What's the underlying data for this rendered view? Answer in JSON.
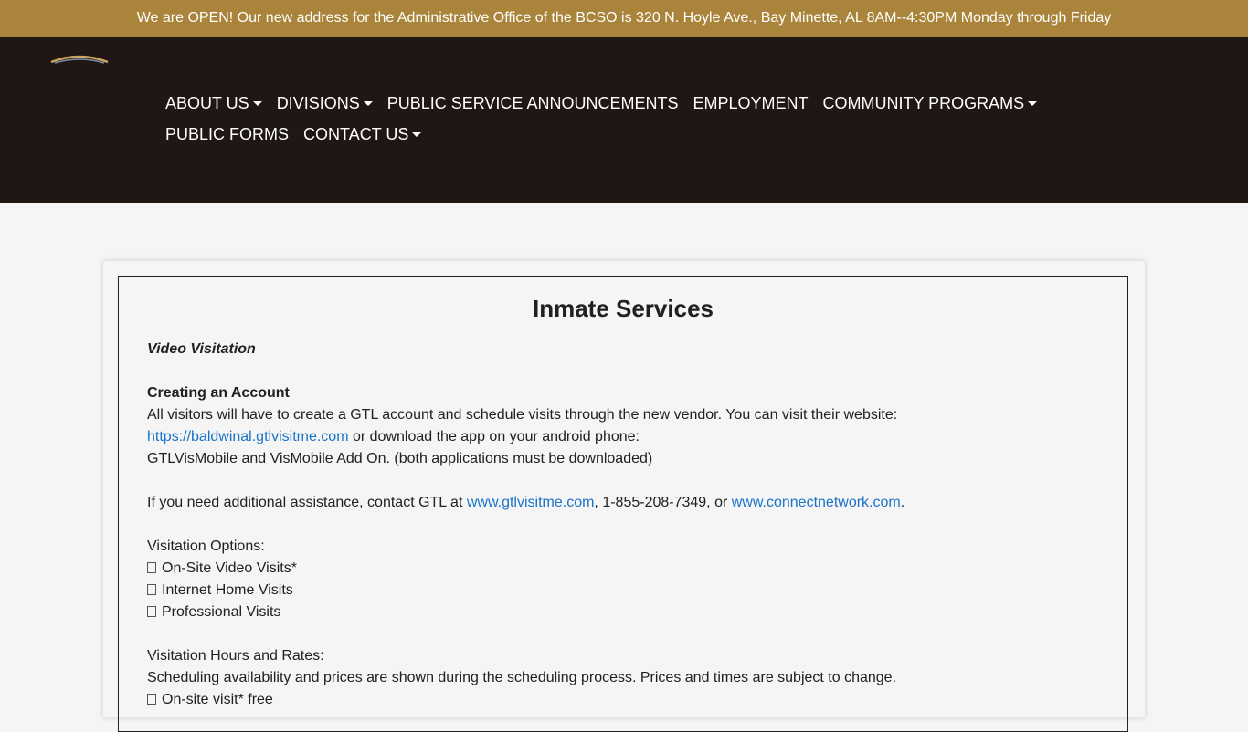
{
  "announcement": "We are OPEN! Our new address for the Administrative Office of the BCSO is 320 N. Hoyle Ave., Bay Minette, AL 8AM--4:30PM Monday through Friday",
  "nav": {
    "about": "ABOUT US",
    "divisions": "DIVISIONS",
    "psa": "PUBLIC SERVICE ANNOUNCEMENTS",
    "employment": "EMPLOYMENT",
    "community": "COMMUNITY PROGRAMS",
    "forms": "PUBLIC FORMS",
    "contact": "CONTACT US"
  },
  "page": {
    "title": "Inmate Services",
    "video_visitation": "Video Visitation",
    "creating_account": "Creating an Account",
    "account_text": "All visitors will have to create a GTL account and schedule visits through the new vendor. You can visit their website:",
    "website_link": "https://baldwinal.gtlvisitme.com",
    "download_text": " or download the app on your android phone:",
    "apps_text": "GTLVisMobile and VisMobile Add On. (both applications must be downloaded)",
    "assist_text": "If you need additional assistance, contact GTL at ",
    "assist_link1": "www.gtlvisitme.com",
    "assist_phone": ", 1-855-208-7349, or ",
    "assist_link2": "www.connectnetwork.com",
    "assist_end": ".",
    "options_heading": "Visitation Options:",
    "options": [
      "On-Site Video Visits*",
      "Internet Home Visits",
      "Professional Visits"
    ],
    "hours_heading": "Visitation Hours and Rates:",
    "hours_text": "Scheduling availability and prices are shown during the scheduling process. Prices and times are subject to change.",
    "onsite_free": "On-site visit* free"
  },
  "colors": {
    "announcement_bg": "#a9843a",
    "header_bg": "#201614",
    "link": "#1a73c8"
  }
}
